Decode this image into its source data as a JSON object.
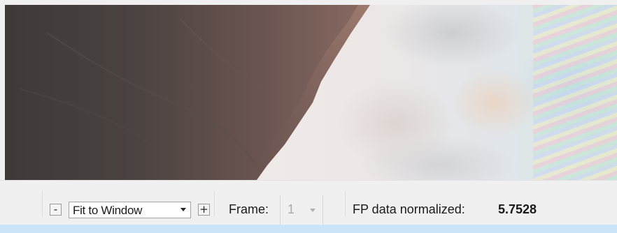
{
  "toolbar": {
    "zoom_out_label": "-",
    "zoom_mode": "Fit to Window",
    "zoom_in_label": "+",
    "frame_label": "Frame:",
    "frame_value": "1",
    "fp_label": "FP data normalized:",
    "fp_value": "5.7528"
  },
  "icons": {
    "zoom_dropdown": "chevron-down-icon",
    "frame_dropdown": "chevron-down-icon"
  },
  "colors": {
    "status_strip": "#cce4f7",
    "toolbar_bg": "#f0f0f0"
  }
}
